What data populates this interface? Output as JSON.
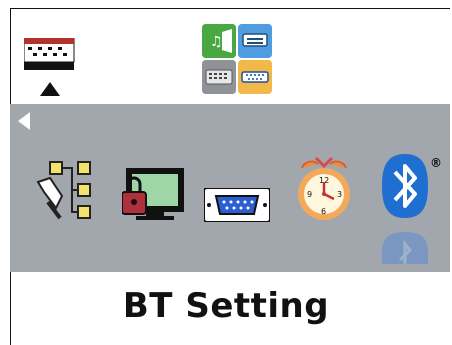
{
  "title": "BT Setting",
  "trademark": "®",
  "icons": {
    "top_left": "keyboard-mode-icon",
    "top_center": [
      "audio-mode-icon",
      "keyboard-mode-icon",
      "ps2-keyboard-icon",
      "serial-port-icon"
    ],
    "band": [
      "network-config-icon",
      "lock-screen-icon",
      "serial-port-icon",
      "alarm-clock-icon",
      "bluetooth-icon"
    ]
  },
  "colors": {
    "band": "#a2a6ad",
    "bluetooth": "#1f6fd1",
    "accent_yellow": "#f3e36a",
    "accent_green": "#4aa842"
  }
}
